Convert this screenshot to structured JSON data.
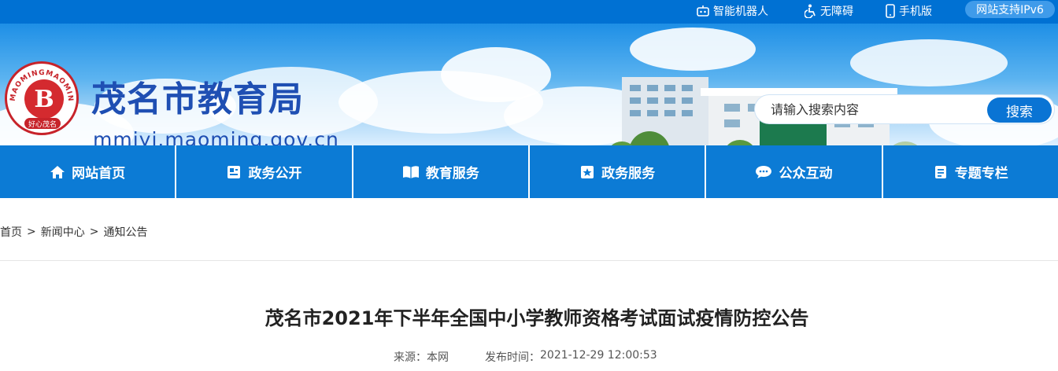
{
  "topbar": {
    "robot_label": "智能机器人",
    "accessibility_label": "无障碍",
    "mobile_label": "手机版",
    "ipv6_label": "网站支持IPv6"
  },
  "header": {
    "logo_ring_text": "MAOMINGMAOMING",
    "logo_initial": "B",
    "logo_foot_text": "好心茂名",
    "site_title": "茂名市教育局",
    "site_url": "mmjyj.maoming.gov.cn"
  },
  "search": {
    "placeholder": "请输入搜索内容",
    "button_label": "搜索"
  },
  "nav": {
    "items": [
      {
        "label": "网站首页",
        "icon": "home-icon"
      },
      {
        "label": "政务公开",
        "icon": "id-card-icon"
      },
      {
        "label": "教育服务",
        "icon": "book-icon"
      },
      {
        "label": "政务服务",
        "icon": "star-bookmark-icon"
      },
      {
        "label": "公众互动",
        "icon": "chat-bubble-icon"
      },
      {
        "label": "专题专栏",
        "icon": "document-icon"
      }
    ]
  },
  "breadcrumb": {
    "items": [
      "首页",
      "新闻中心",
      "通知公告"
    ],
    "separator": ">"
  },
  "article": {
    "title": "茂名市2021年下半年全国中小学教师资格考试面试疫情防控公告",
    "source_label": "来源：",
    "source_value": "本网",
    "date_label": "发布时间：",
    "date_value": "2021-12-29 12:00:53"
  },
  "colors": {
    "topbar": "#0071d3",
    "nav": "#0c7bd5",
    "title_blue": "#1f4fb3",
    "logo_red": "#c7232a"
  }
}
